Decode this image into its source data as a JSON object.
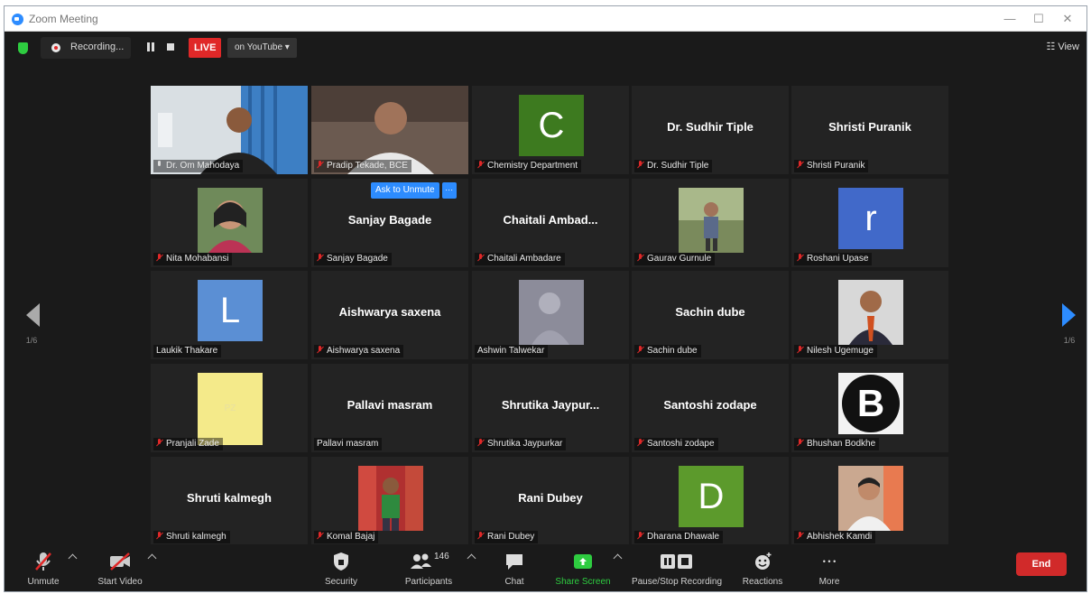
{
  "window": {
    "title": "Zoom Meeting",
    "minimize": "—",
    "maximize": "☐",
    "close": "✕"
  },
  "topbar": {
    "recording_label": "Recording...",
    "live_label": "LIVE",
    "live_destination": "on YouTube ▾",
    "view_label": "☷ View"
  },
  "pager": {
    "left_text": "1/6",
    "right_text": "1/6"
  },
  "colors": {
    "accent": "#2d8cff",
    "live": "#e02828",
    "end": "#d12a2a",
    "active_speaker": "#e6f24e"
  },
  "ask_to_unmute": {
    "label": "Ask to Unmute",
    "more": "···"
  },
  "tiles": [
    {
      "name": "Dr. Om Mahodaya",
      "kind": "video",
      "mic": "speaking",
      "active": true
    },
    {
      "name": "Pradip Tekade, BCE",
      "kind": "video",
      "mic": "muted"
    },
    {
      "name": "Chemistry Department",
      "kind": "avatar",
      "letter": "C",
      "color": "#3d7a1f",
      "mic": "muted"
    },
    {
      "name": "Dr. Sudhir Tiple",
      "kind": "text",
      "title": "Dr. Sudhir Tiple",
      "mic": "muted"
    },
    {
      "name": "Shristi Puranik",
      "kind": "text",
      "title": "Shristi Puranik",
      "mic": "muted"
    },
    {
      "name": "Nita Mohabansi",
      "kind": "photo",
      "mic": "muted"
    },
    {
      "name": "Sanjay Bagade",
      "kind": "text",
      "title": "Sanjay Bagade",
      "mic": "muted",
      "ask": true
    },
    {
      "name": "Chaitali Ambadare",
      "kind": "text",
      "title": "Chaitali  Ambad...",
      "mic": "muted"
    },
    {
      "name": "Gaurav Gurnule",
      "kind": "photo",
      "mic": "muted"
    },
    {
      "name": "Roshani Upase",
      "kind": "avatar",
      "letter": "r",
      "color": "#4169c9",
      "mic": "muted"
    },
    {
      "name": "Laukik Thakare",
      "kind": "avatar",
      "letter": "L",
      "color": "#5b8fd4",
      "mic": "none"
    },
    {
      "name": "Aishwarya saxena",
      "kind": "text",
      "title": "Aishwarya saxena",
      "mic": "muted"
    },
    {
      "name": "Ashwin Talwekar",
      "kind": "photo",
      "mic": "none"
    },
    {
      "name": "Sachin dube",
      "kind": "text",
      "title": "Sachin dube",
      "mic": "muted"
    },
    {
      "name": "Nilesh Ugemuge",
      "kind": "photo",
      "mic": "muted"
    },
    {
      "name": "Pranjali Zade",
      "kind": "avatar",
      "letter": "PZ",
      "color": "#f4ea8a",
      "mic": "muted"
    },
    {
      "name": "Pallavi masram",
      "kind": "text",
      "title": "Pallavi masram",
      "mic": "none"
    },
    {
      "name": "Shrutika Jaypurkar",
      "kind": "text",
      "title": "Shrutika  Jaypur...",
      "mic": "muted"
    },
    {
      "name": "Santoshi zodape",
      "kind": "text",
      "title": "Santoshi zodape",
      "mic": "muted"
    },
    {
      "name": "Bhushan Bodkhe",
      "kind": "avatar-b",
      "letter": "B",
      "mic": "muted"
    },
    {
      "name": "Shruti kalmegh",
      "kind": "text",
      "title": "Shruti kalmegh",
      "mic": "muted"
    },
    {
      "name": "Komal Bajaj",
      "kind": "photo",
      "mic": "muted"
    },
    {
      "name": "Rani Dubey",
      "kind": "text",
      "title": "Rani Dubey",
      "mic": "muted"
    },
    {
      "name": "Dharana Dhawale",
      "kind": "avatar",
      "letter": "D",
      "color": "#5c9a2c",
      "mic": "muted"
    },
    {
      "name": "Abhishek Kamdi",
      "kind": "photo",
      "mic": "muted"
    }
  ],
  "controls": {
    "unmute": "Unmute",
    "start_video": "Start Video",
    "security": "Security",
    "participants": "Participants",
    "participants_count": "146",
    "chat": "Chat",
    "share_screen": "Share Screen",
    "pause_stop_recording": "Pause/Stop Recording",
    "reactions": "Reactions",
    "more": "More",
    "more_dots": "• • •",
    "end": "End"
  }
}
